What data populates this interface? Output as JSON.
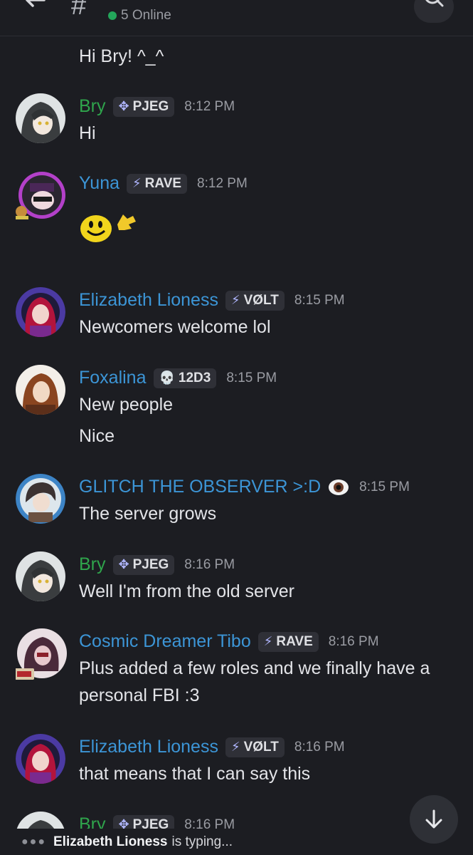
{
  "header": {
    "online_text": "5 Online",
    "accent_online": "#23a55a"
  },
  "messages": [
    {
      "lines": [
        "Hi Bry! ^_^"
      ]
    },
    {
      "author": "Bry",
      "tag": "PJEG",
      "time": "8:12 PM",
      "lines": [
        "Hi"
      ]
    },
    {
      "author": "Yuna",
      "tag": "RAVE",
      "time": "8:12 PM",
      "lines": []
    },
    {
      "author": "Elizabeth Lioness",
      "tag": "VØLT",
      "time": "8:15 PM",
      "lines": [
        "Newcomers welcome lol"
      ]
    },
    {
      "author": "Foxalina",
      "tag": "12D3",
      "time": "8:15 PM",
      "lines": [
        "New people",
        "Nice"
      ]
    },
    {
      "author": "GLITCH THE OBSERVER >:D",
      "time": "8:15 PM",
      "lines": [
        "The server grows"
      ]
    },
    {
      "author": "Bry",
      "tag": "PJEG",
      "time": "8:16 PM",
      "lines": [
        "Well I'm from the old server"
      ]
    },
    {
      "author": "Cosmic Dreamer Tibo",
      "tag": "RAVE",
      "time": "8:16 PM",
      "lines": [
        "Plus added a few roles and we finally have a",
        "personal FBI :3"
      ]
    },
    {
      "author": "Elizabeth Lioness",
      "tag": "VØLT",
      "time": "8:16 PM",
      "lines": [
        "that means that I can say this"
      ]
    },
    {
      "author": "Bry",
      "tag": "PJEG",
      "time": "8:16 PM",
      "lines": []
    }
  ],
  "typing": {
    "user": "Elizabeth Lioness",
    "text": "is typing..."
  },
  "colors": {
    "name_green": "#2fa54c",
    "name_blue": "#3c95d6",
    "background": "#1c1d22"
  },
  "icons": [
    "back-arrow-icon",
    "hash-icon",
    "search-icon",
    "pjeg-tag-icon",
    "rave-bolt-icon",
    "volt-bolt-icon",
    "skull-icon",
    "eye-icon",
    "arrow-down-icon",
    "typing-dots-icon"
  ]
}
